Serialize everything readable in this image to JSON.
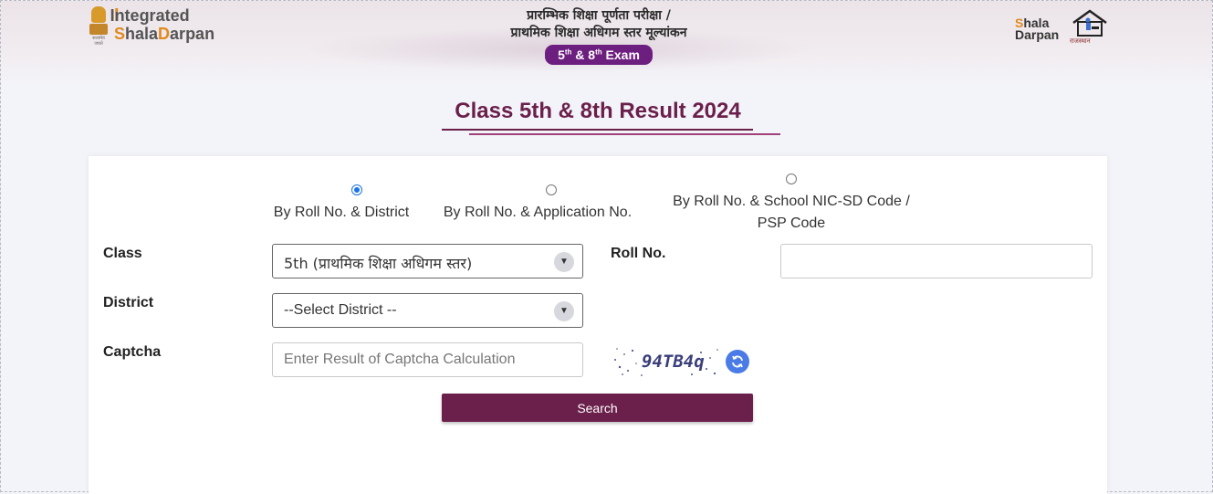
{
  "header": {
    "logo_left_line1": "Integrated",
    "logo_left_line2_a": "S",
    "logo_left_line2_b": "hala",
    "logo_left_line2_c": "D",
    "logo_left_line2_d": "arpan",
    "hindi_line1": "प्रारम्भिक शिक्षा पूर्णता परीक्षा /",
    "hindi_line2": "प्राथमिक शिक्षा अधिगम स्तर मूल्यांकन",
    "exam_badge": "5th & 8th Exam",
    "logo_right_line1_a": "S",
    "logo_right_line1_b": "hala",
    "logo_right_line2": "Darpan",
    "logo_right_sub": "राजस्थान"
  },
  "title": "Class 5th & 8th Result 2024",
  "search_options": [
    {
      "label": "By Roll No. & District",
      "selected": true
    },
    {
      "label": "By Roll No. & Application No.",
      "selected": false
    },
    {
      "label_line1": "By Roll No. & School NIC-SD Code /",
      "label_line2": "PSP Code",
      "selected": false
    }
  ],
  "form": {
    "class_label": "Class",
    "class_value": "5th (प्राथमिक शिक्षा अधिगम स्तर)",
    "district_label": "District",
    "district_value": "--Select District --",
    "captcha_label": "Captcha",
    "captcha_placeholder": "Enter Result of Captcha Calculation",
    "captcha_text": "94TB4q",
    "roll_label": "Roll No.",
    "roll_value": "",
    "search_button": "Search"
  },
  "colors": {
    "brand": "#6b1f4b",
    "badge": "#6d1f7f",
    "accent": "#e08a1e",
    "radio_selected": "#1a73e8",
    "refresh": "#4a7be6"
  }
}
